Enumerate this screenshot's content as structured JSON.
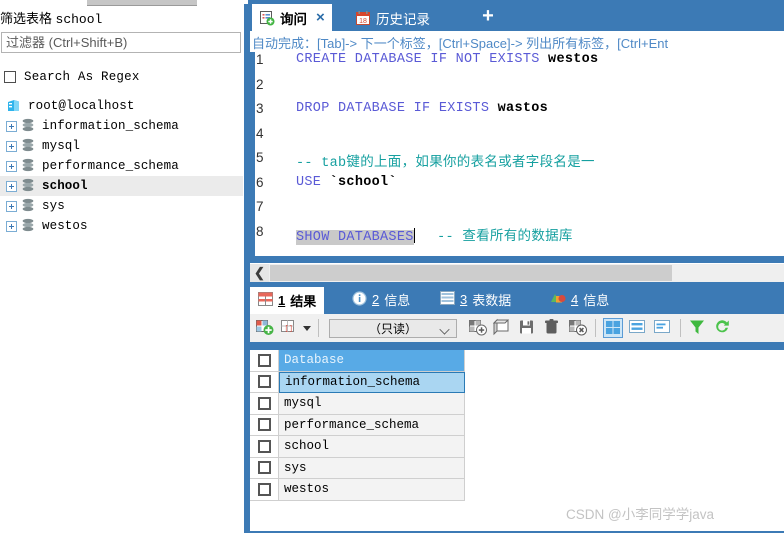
{
  "sidebar": {
    "title_prefix": "筛选表格",
    "title_value": "school",
    "filter_placeholder": "过滤器 (Ctrl+Shift+B)",
    "regex_label": "Search As Regex",
    "tree": {
      "root": "root@localhost",
      "items": [
        {
          "label": "information_schema",
          "selected": false
        },
        {
          "label": "mysql",
          "selected": false
        },
        {
          "label": "performance_schema",
          "selected": false
        },
        {
          "label": "school",
          "selected": true
        },
        {
          "label": "sys",
          "selected": false
        },
        {
          "label": "westos",
          "selected": false
        }
      ]
    }
  },
  "editor_tabs": {
    "query": {
      "label": "询问",
      "close": "×"
    },
    "history": {
      "label": "历史记录",
      "badge": "18"
    },
    "add": "+"
  },
  "editor": {
    "autocomplete_hint": "自动完成：[Tab]-> 下一个标签，[Ctrl+Space]-> 列出所有标签，[Ctrl+Ent",
    "lines": [
      {
        "n": "1",
        "kw": "CREATE DATABASE IF NOT EXISTS",
        "id": " westos",
        "cmt": ""
      },
      {
        "n": "2",
        "kw": "",
        "id": "",
        "cmt": ""
      },
      {
        "n": "3",
        "kw": "DROP DATABASE IF EXISTS",
        "id": " wastos",
        "cmt": ""
      },
      {
        "n": "4",
        "kw": "",
        "id": "",
        "cmt": ""
      },
      {
        "n": "5",
        "kw": "",
        "id": "",
        "cmt": "-- tab键的上面，如果你的表名或者字段名是一"
      },
      {
        "n": "6",
        "kw": "USE",
        "id": " `school`",
        "cmt": ""
      },
      {
        "n": "7",
        "kw": "",
        "id": "",
        "cmt": ""
      },
      {
        "n": "8",
        "kw": "SHOW DATABASES",
        "id": "",
        "cmt": "-- 查看所有的数据库"
      }
    ]
  },
  "result_tabs": [
    {
      "num": "1",
      "text": "结果",
      "icon": "grid-icon",
      "active": true
    },
    {
      "num": "2",
      "text": "信息",
      "icon": "info-icon",
      "active": false
    },
    {
      "num": "3",
      "text": "表数据",
      "icon": "table-icon",
      "active": false
    },
    {
      "num": "4",
      "text": "信息",
      "icon": "chart-icon",
      "active": false
    }
  ],
  "result_toolbar": {
    "mode_value": "（只读）",
    "icons": [
      "add-record-icon",
      "record-options-icon",
      "insert-record-icon",
      "duplicate-record-icon",
      "save-record-icon",
      "delete-record-icon",
      "cancel-record-icon",
      "grid-view-icon",
      "form-view-icon",
      "text-view-icon",
      "filter-icon",
      "refresh-icon"
    ]
  },
  "grid": {
    "column": "Database",
    "rows": [
      "information_schema",
      "mysql",
      "performance_schema",
      "school",
      "sys",
      "westos"
    ]
  },
  "watermark": "CSDN @小李同学学java",
  "colors": {
    "chrome_blue": "#3c7ab5",
    "keyword": "#5a5ad6",
    "comment": "#16a0a0",
    "header_blue": "#58aae6",
    "selected_row": "#aad6f2",
    "hint_blue": "#4f89c6"
  }
}
